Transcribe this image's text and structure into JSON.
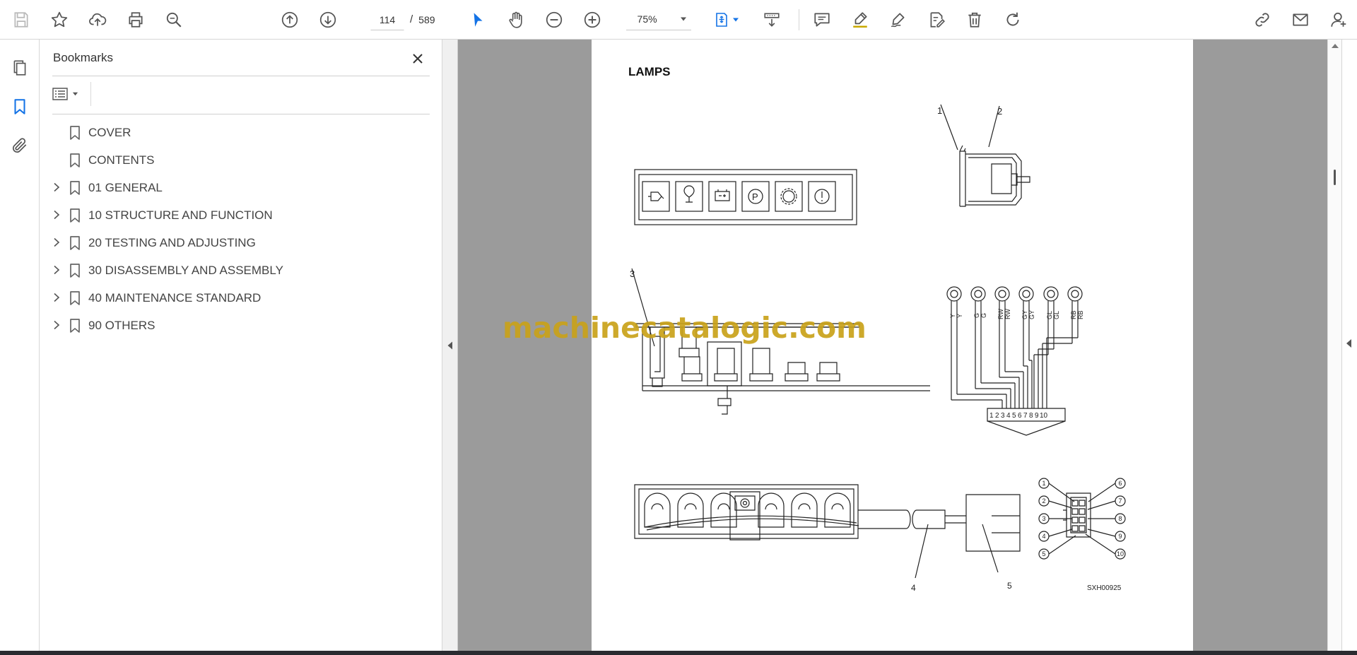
{
  "toolbar": {
    "page_current": "114",
    "page_separator": "/",
    "page_total": "589",
    "zoom": "75%",
    "accent": "#1473e6"
  },
  "bookmarks": {
    "title": "Bookmarks",
    "items": [
      {
        "label": "COVER",
        "expandable": false
      },
      {
        "label": "CONTENTS",
        "expandable": false
      },
      {
        "label": "01 GENERAL",
        "expandable": true
      },
      {
        "label": "10 STRUCTURE AND FUNCTION",
        "expandable": true
      },
      {
        "label": "20 TESTING AND ADJUSTING",
        "expandable": true
      },
      {
        "label": "30 DISASSEMBLY AND ASSEMBLY",
        "expandable": true
      },
      {
        "label": "40 MAINTENANCE STANDARD",
        "expandable": true
      },
      {
        "label": "90 OTHERS",
        "expandable": true
      }
    ]
  },
  "document": {
    "heading": "LAMPS",
    "watermark": "machinecatalogic.com",
    "watermark_color": "#c9a21a",
    "callouts": [
      "1",
      "2",
      "3",
      "4",
      "5"
    ],
    "wire_codes": [
      "Y",
      "Y",
      "G",
      "G",
      "RW",
      "RW",
      "GY",
      "GY",
      "GL",
      "GL",
      "RB",
      "RB"
    ],
    "pin_numbers": [
      "1",
      "2",
      "3",
      "4",
      "5",
      "6",
      "7",
      "8",
      "9",
      "10"
    ],
    "connector_pins": [
      "1",
      "2",
      "3",
      "4",
      "5",
      "6",
      "7",
      "8",
      "9",
      "10"
    ],
    "figure_code": "SXH00925"
  }
}
